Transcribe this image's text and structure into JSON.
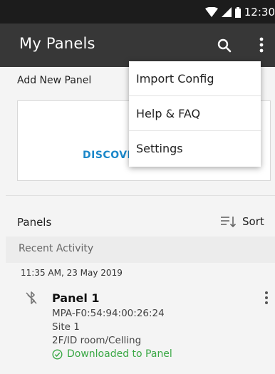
{
  "status_bar": {
    "time": "12:30"
  },
  "app_bar": {
    "title": "My Panels"
  },
  "add_panel": {
    "title": "Add New Panel",
    "discover_label": "DISCOVER"
  },
  "panels_section": {
    "title": "Panels",
    "sort_label": "Sort",
    "recent_label": "Recent Activity"
  },
  "activity": {
    "timestamp": "11:35 AM, 23 May 2019",
    "panel": {
      "name": "Panel 1",
      "id": "MPA-F0:54:94:00:26:24",
      "site": "Site 1",
      "location": "2F/ID room/Celling",
      "status": "Downloaded to Panel"
    }
  },
  "menu": {
    "items": [
      "Import Config",
      "Help & FAQ",
      "Settings"
    ]
  },
  "colors": {
    "app_bar": "#373737",
    "status_bar": "#1c1c1c",
    "accent": "#1b87c9",
    "success": "#3aa845"
  }
}
